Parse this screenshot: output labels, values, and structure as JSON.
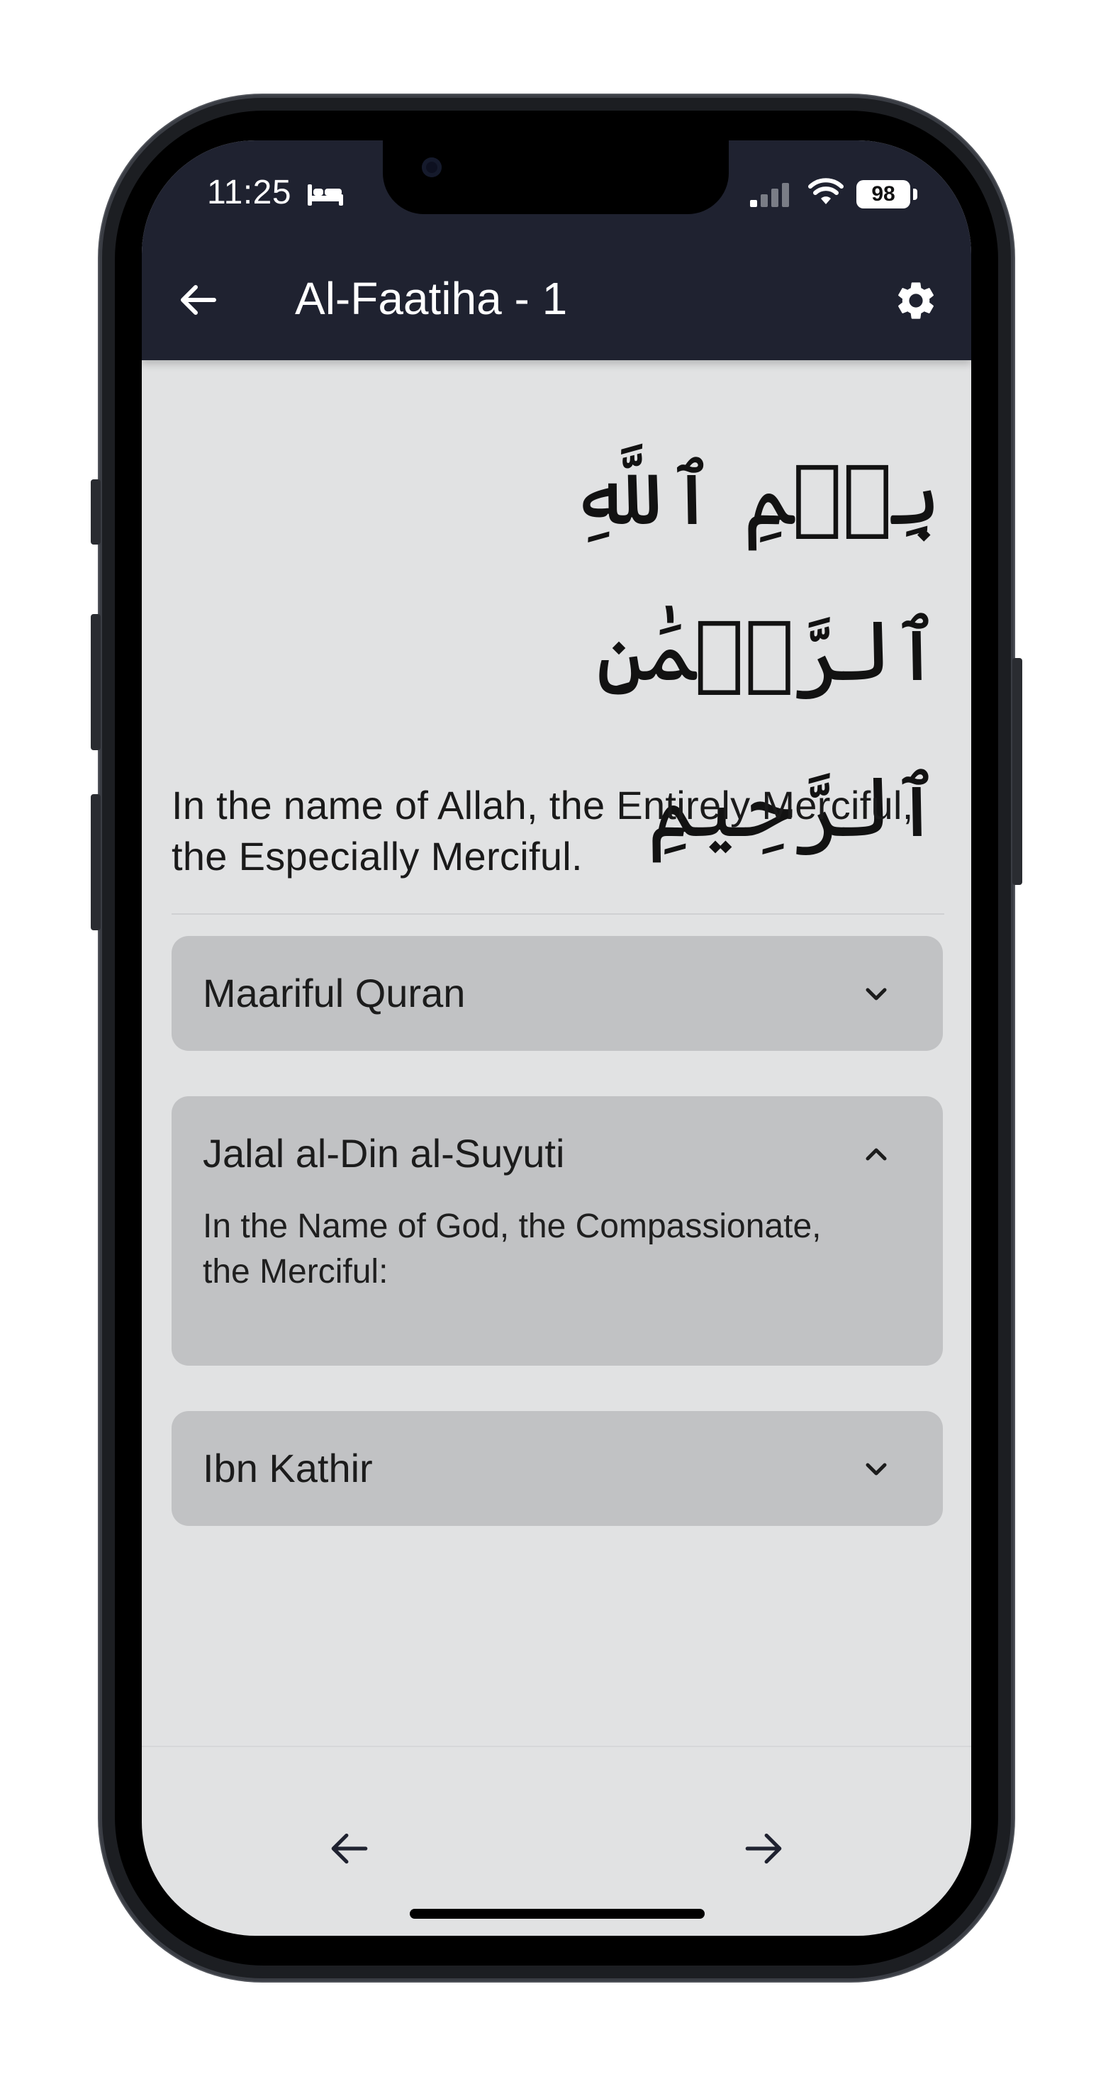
{
  "status_bar": {
    "time": "11:25",
    "battery": "98"
  },
  "header": {
    "title": "Al-Faatiha - 1"
  },
  "verse": {
    "arabic": "بِسۡمِ ٱللَّهِ ٱلرَّحۡمَٰنِ ٱلرَّحِيمِ",
    "translation": "In the name of Allah, the Entirely Merciful, the Especially Merciful."
  },
  "tafsir": [
    {
      "title": "Maariful Quran",
      "expanded": false,
      "body": ""
    },
    {
      "title": "Jalal al-Din al-Suyuti",
      "expanded": true,
      "body": "In the Name of God, the Compassionate, the Merciful:"
    },
    {
      "title": "Ibn Kathir",
      "expanded": false,
      "body": ""
    }
  ],
  "icons": {
    "back": "arrow-left-icon",
    "settings": "gear-icon",
    "prev": "arrow-left-icon",
    "next": "arrow-right-icon",
    "collapsed": "chevron-down-icon",
    "expanded": "chevron-up-icon"
  },
  "colors": {
    "header_bg": "#1f2230",
    "screen_bg": "#e1e2e3",
    "card_bg": "#c1c2c4"
  }
}
